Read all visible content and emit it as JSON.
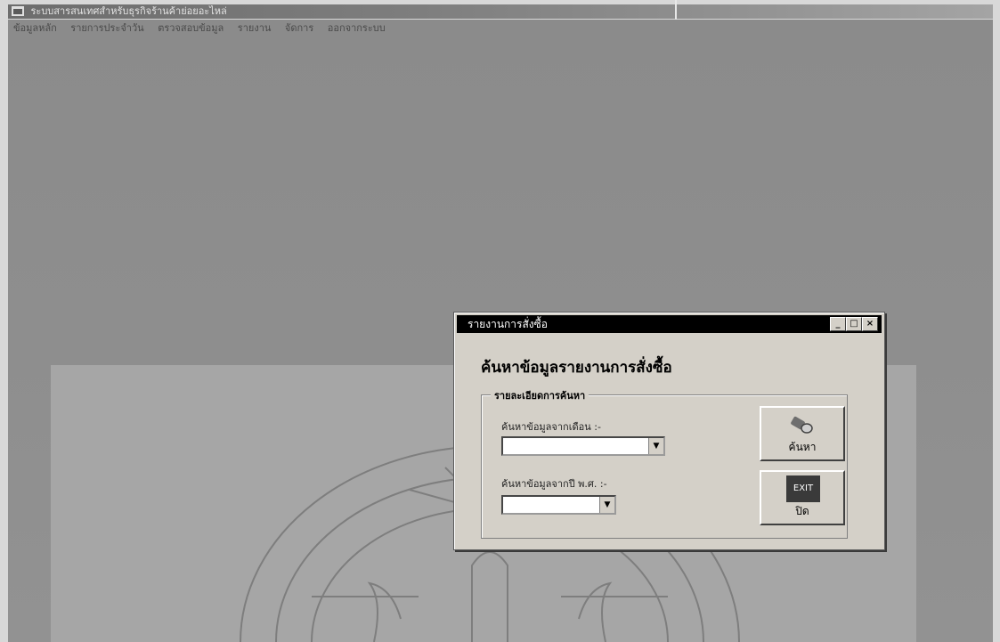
{
  "window": {
    "title": "ระบบสารสนเทศสำหรับธุรกิจร้านค้าย่อยอะไหล่",
    "menu": [
      "ข้อมูลหลัก",
      "รายการประจำวัน",
      "ตรวจสอบข้อมูล",
      "รายงาน",
      "จัดการ",
      "ออกจากระบบ"
    ]
  },
  "dialog": {
    "title": "รายงานการสั่งซื้อ",
    "heading": "ค้นหาข้อมูลรายงานการสั่งซื้อ",
    "group_label": "รายละเอียดการค้นหา",
    "month_label": "ค้นหาข้อมูลจากเดือน :-",
    "month_value": "",
    "year_label": "ค้นหาข้อมูลจากปี พ.ศ. :-",
    "year_value": "",
    "search_button": "ค้นหา",
    "close_button": "ปิด",
    "exit_icon_text": "EXIT"
  }
}
